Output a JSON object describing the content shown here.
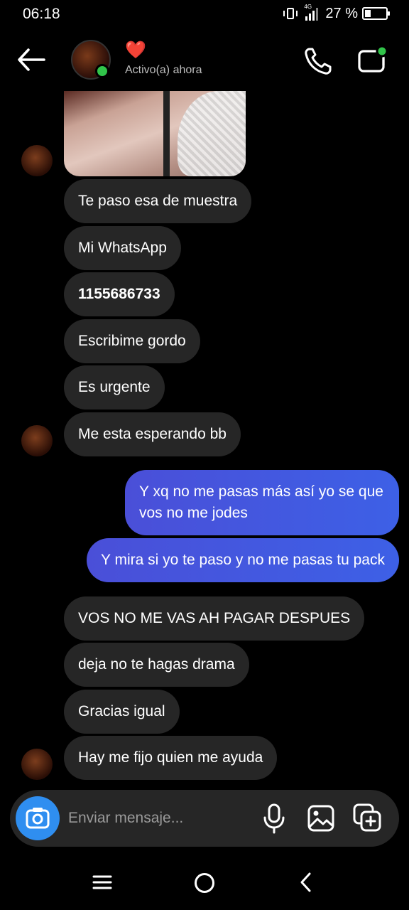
{
  "status_bar": {
    "time": "06:18",
    "network": "4G",
    "battery_percent": "27 %",
    "battery_level": 0.27
  },
  "header": {
    "status_emoji": "❤️",
    "activity": "Activo(a) ahora",
    "icons": [
      "back-arrow-icon",
      "phone-icon",
      "video-call-icon"
    ]
  },
  "messages": [
    {
      "from": "them",
      "text": "Te paso esa de muestra"
    },
    {
      "from": "them",
      "text": "Mi WhatsApp"
    },
    {
      "from": "them",
      "text": "1155686733"
    },
    {
      "from": "them",
      "text": "Escribime gordo"
    },
    {
      "from": "them",
      "text": "Es urgente"
    },
    {
      "from": "them",
      "text": "Me esta esperando bb"
    },
    {
      "from": "me",
      "text": "Y xq no me pasas más así yo se que vos no me jodes"
    },
    {
      "from": "me",
      "text": "Y mira si yo te paso y no me pasas tu pack"
    },
    {
      "from": "them",
      "text": "VOS NO ME VAS AH PAGAR DESPUES"
    },
    {
      "from": "them",
      "text": "deja no te hagas drama"
    },
    {
      "from": "them",
      "text": "Gracias igual"
    },
    {
      "from": "them",
      "text": "Hay me fijo quien me ayuda"
    }
  ],
  "composer": {
    "placeholder": "Enviar mensaje...",
    "icons": [
      "camera-icon",
      "microphone-icon",
      "gallery-icon",
      "sticker-icon"
    ]
  },
  "colors": {
    "incoming_bubble": "#262626",
    "outgoing_bubble": "#4a4fd8",
    "camera_button": "#2f8ef0",
    "online": "#31c44a"
  }
}
